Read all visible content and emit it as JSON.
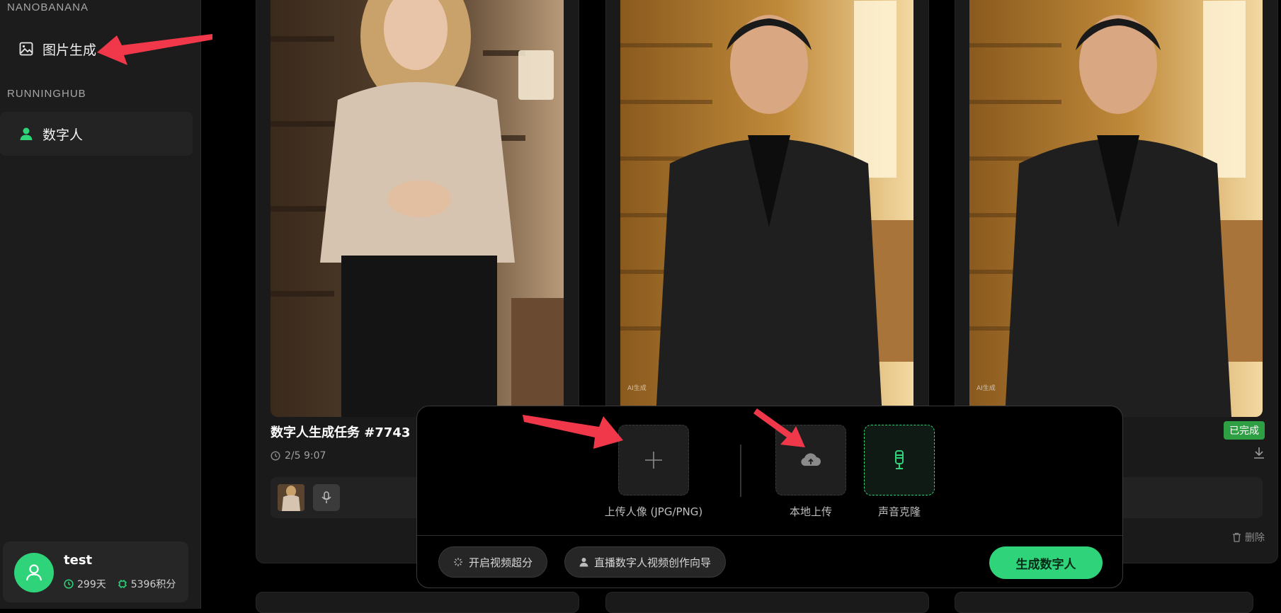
{
  "sidebar": {
    "sections": [
      {
        "title": "NANOBANANA",
        "items": [
          {
            "label": "图片生成",
            "icon": "image-icon"
          }
        ]
      },
      {
        "title": "RUNNINGHUB",
        "items": [
          {
            "label": "数字人",
            "icon": "person-icon",
            "active": true
          }
        ]
      }
    ],
    "user": {
      "name": "test",
      "days": "299天",
      "points": "5396积分"
    }
  },
  "cards": [
    {
      "title": "数字人生成任务 #7743",
      "time": "2/5 9:07"
    },
    {
      "watermark": "AI生成"
    },
    {
      "watermark": "AI生成",
      "status": "已完成",
      "delete_label": "删除"
    }
  ],
  "panel": {
    "upload_portrait_label": "上传人像 (JPG/PNG)",
    "local_upload_label": "本地上传",
    "voice_clone_label": "声音克隆",
    "super_res_label": "开启视频超分",
    "guide_label": "直播数字人视频创作向导",
    "generate_label": "生成数字人"
  },
  "colors": {
    "accent": "#2fd37a",
    "arrow": "#f0384a",
    "badge": "#2ea043"
  }
}
